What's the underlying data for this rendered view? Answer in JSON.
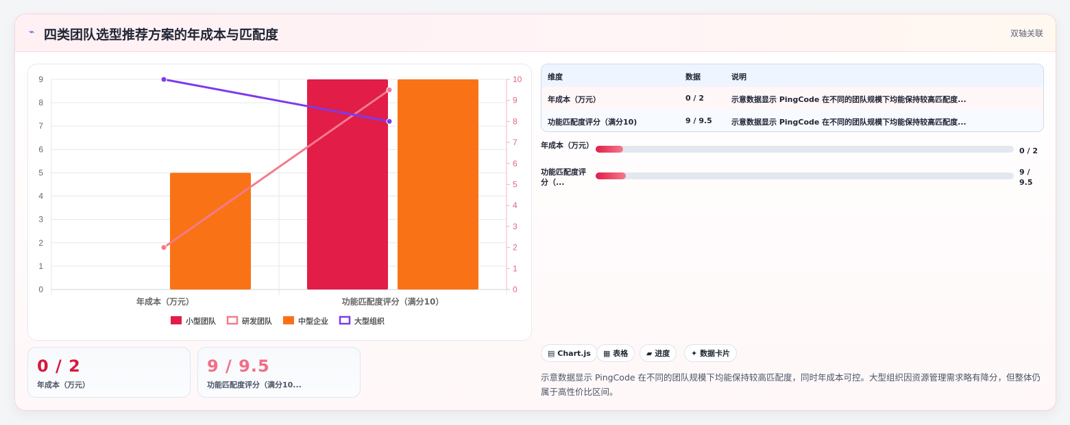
{
  "header": {
    "icon": "⌁",
    "title": "四类团队选型推荐方案的年成本与匹配度",
    "linkage": "双轴关联"
  },
  "chart_data": {
    "type": "bar",
    "categories": [
      "年成本（万元）",
      "功能匹配度评分（满分10）"
    ],
    "series": [
      {
        "name": "小型团队",
        "type": "bar",
        "axis": "left",
        "color": "#e11d48",
        "values": [
          null,
          9
        ]
      },
      {
        "name": "研发团队",
        "type": "line",
        "axis": "right",
        "color": "#f47a8c",
        "values": [
          2,
          9.5
        ]
      },
      {
        "name": "中型企业",
        "type": "bar",
        "axis": "left",
        "color": "#f97316",
        "values": [
          5,
          9
        ]
      },
      {
        "name": "大型组织",
        "type": "line",
        "axis": "right",
        "color": "#7c3aed",
        "values": [
          10,
          8
        ]
      }
    ],
    "y_left": {
      "range": [
        0,
        9
      ],
      "ticks": [
        "0",
        "1",
        "2",
        "3",
        "4",
        "5",
        "6",
        "7",
        "8",
        "9"
      ]
    },
    "y_right": {
      "range": [
        0,
        10
      ],
      "ticks": [
        "0",
        "1",
        "2",
        "3",
        "4",
        "5",
        "6",
        "7",
        "8",
        "9",
        "10"
      ],
      "color": "#e2667a"
    },
    "grid": true,
    "legend_position": "bottom"
  },
  "kpis": [
    {
      "value": "0 / 2",
      "label": "年成本（万元）",
      "color": "#d7193f"
    },
    {
      "value": "9 / 9.5",
      "label": "功能匹配度评分（满分10...",
      "color": "#f06f86"
    }
  ],
  "table": {
    "headers": [
      "维度",
      "数据",
      "说明"
    ],
    "rows": [
      [
        "年成本（万元）",
        "0 / 2",
        "示意数据显示 PingCode 在不同的团队规模下均能保持较高匹配度..."
      ],
      [
        "功能匹配度评分（满分10)",
        "9 / 9.5",
        "示意数据显示 PingCode 在不同的团队规模下均能保持较高匹配度..."
      ]
    ]
  },
  "progress": [
    {
      "label": "年成本（万元）",
      "value": "0 / 2",
      "fill_fraction": 0.065
    },
    {
      "label": "功能匹配度评分（...",
      "value": "9 / 9.5",
      "fill_fraction": 0.072
    }
  ],
  "chips": [
    {
      "icon": "chart-icon",
      "glyph": "▤",
      "label": "Chart.js"
    },
    {
      "icon": "table-icon",
      "glyph": "▦",
      "label": "表格"
    },
    {
      "icon": "progress-icon",
      "glyph": "▰",
      "label": "进度"
    },
    {
      "icon": "sparkle-icon",
      "glyph": "✦",
      "label": "数据卡片"
    }
  ],
  "description": "示意数据显示 PingCode 在不同的团队规模下均能保持较高匹配度，同时年成本可控。大型组织因资源管理需求略有降分，但整体仍属于高性价比区间。"
}
